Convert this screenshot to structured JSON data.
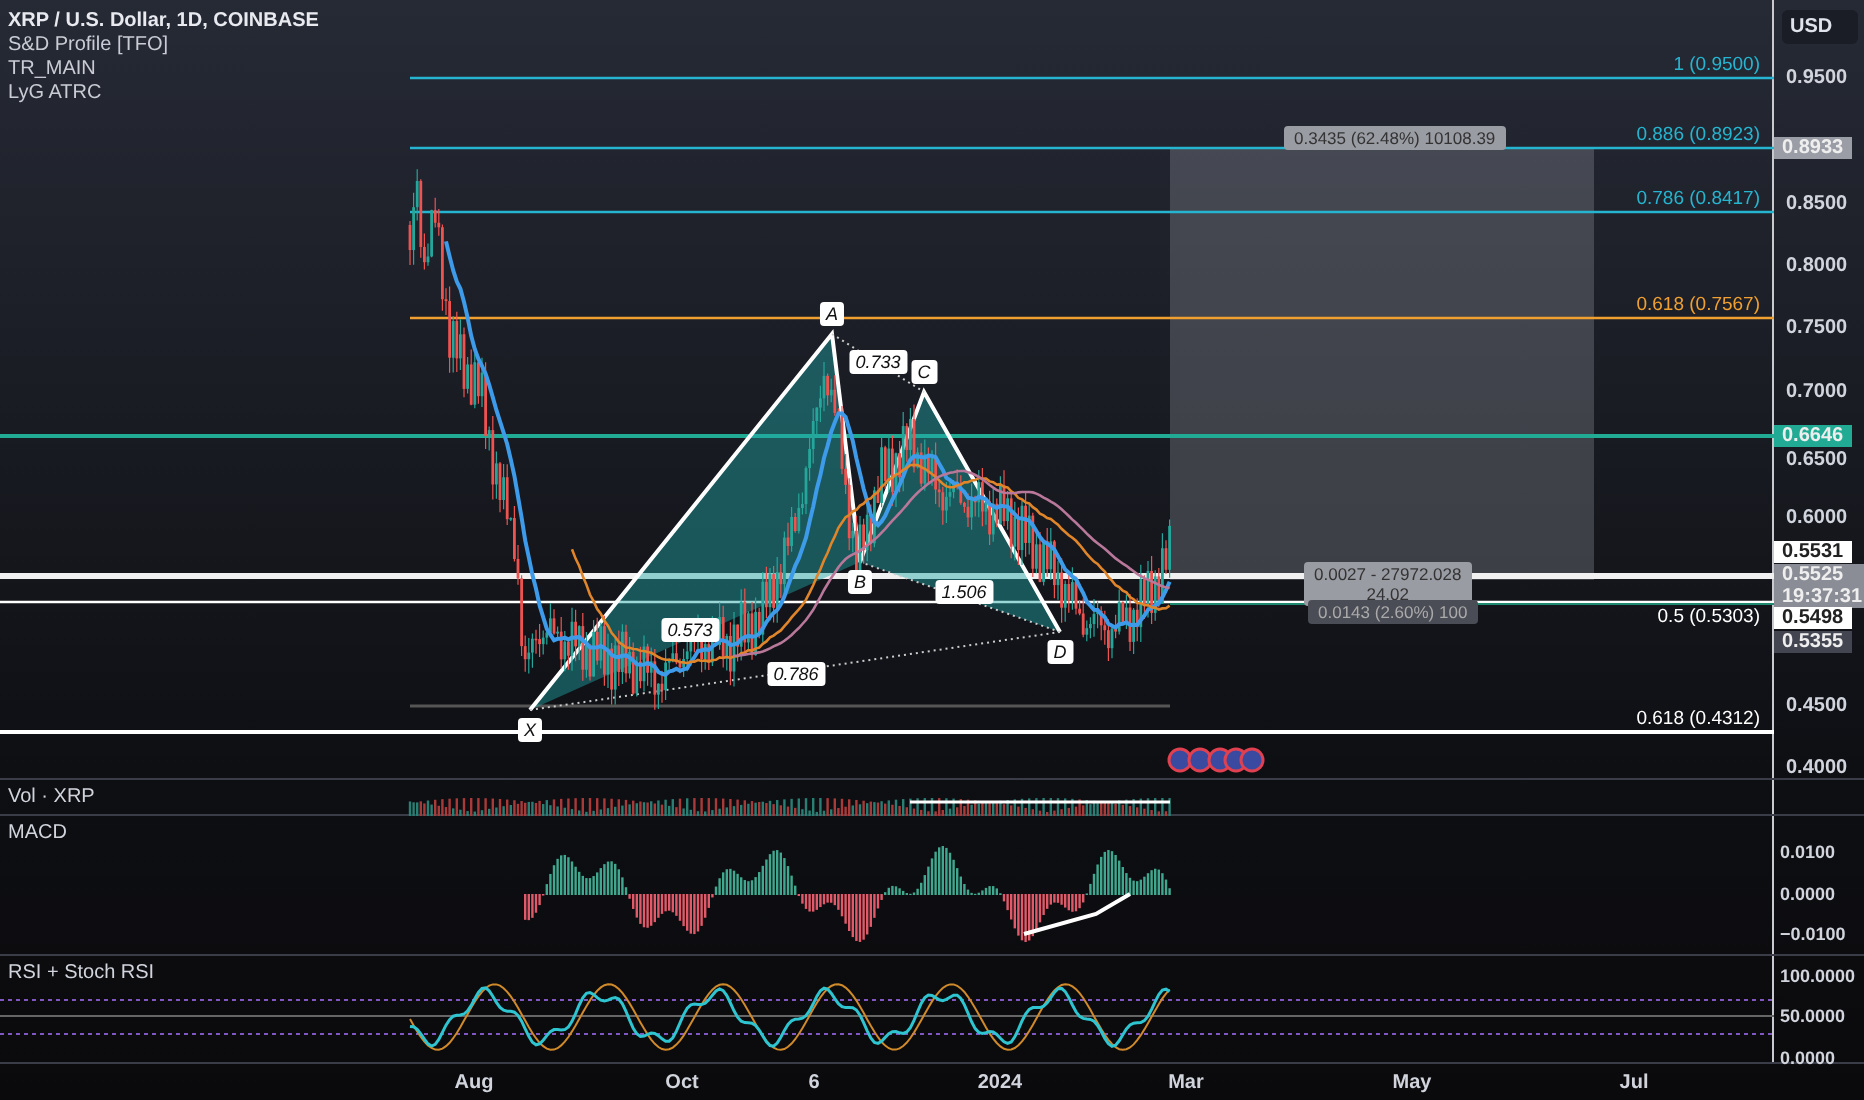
{
  "legend": {
    "title": "XRP / U.S. Dollar, 1D, COINBASE",
    "indicators": [
      "S&D Profile [TFO]",
      "TR_MAIN",
      "LyG ATRC"
    ]
  },
  "price_axis": {
    "currency": "USD",
    "ticks": [
      "0.9500",
      "0.8500",
      "0.8000",
      "0.7500",
      "0.7000",
      "0.6500",
      "0.6000",
      "0.4500",
      "0.4000"
    ]
  },
  "price_tags": [
    {
      "text": "0.8933",
      "color": "#9a9da6"
    },
    {
      "text": "0.6646",
      "color": "#22ab94"
    },
    {
      "text": "0.5531",
      "color": "#ffffff"
    },
    {
      "text": "0.5525",
      "countdown": "19:37:31",
      "color": "#8a8d96"
    },
    {
      "text": "0.5498",
      "color": "#ffffff"
    },
    {
      "text": "0.5355",
      "color": "#434651"
    }
  ],
  "fib_levels": [
    {
      "label": "1 (0.9500)",
      "color": "#26b5d0"
    },
    {
      "label": "0.886 (0.8923)",
      "color": "#26b5d0"
    },
    {
      "label": "0.786 (0.8417)",
      "color": "#26b5d0"
    },
    {
      "label": "0.618 (0.7567)",
      "color": "#f0a030"
    },
    {
      "label": "0.5 (0.5303)",
      "color": "#ffffff"
    },
    {
      "label": "0.618 (0.4312)",
      "color": "#ffffff"
    }
  ],
  "pattern": {
    "points": [
      "X",
      "A",
      "B",
      "C",
      "D"
    ],
    "ratios": [
      "0.573",
      "0.733",
      "1.506",
      "0.786"
    ]
  },
  "measurements": [
    {
      "lines": [
        "0.3435 (62.48%) 10108.39"
      ]
    },
    {
      "lines": [
        "0.0027 - 27972.028",
        "24.02"
      ]
    },
    {
      "lines": [
        "0.0143 (2.60%) 100"
      ]
    }
  ],
  "panes": [
    {
      "title": "Vol · XRP"
    },
    {
      "title": "MACD",
      "ticks": [
        "0.0100",
        "0.0000",
        "−0.0100"
      ]
    },
    {
      "title": "RSI + Stoch RSI",
      "ticks": [
        "100.0000",
        "50.0000",
        "0.0000"
      ]
    }
  ],
  "time_axis": [
    "Aug",
    "Oct",
    "6",
    "2024",
    "Mar",
    "May",
    "Jul"
  ]
}
